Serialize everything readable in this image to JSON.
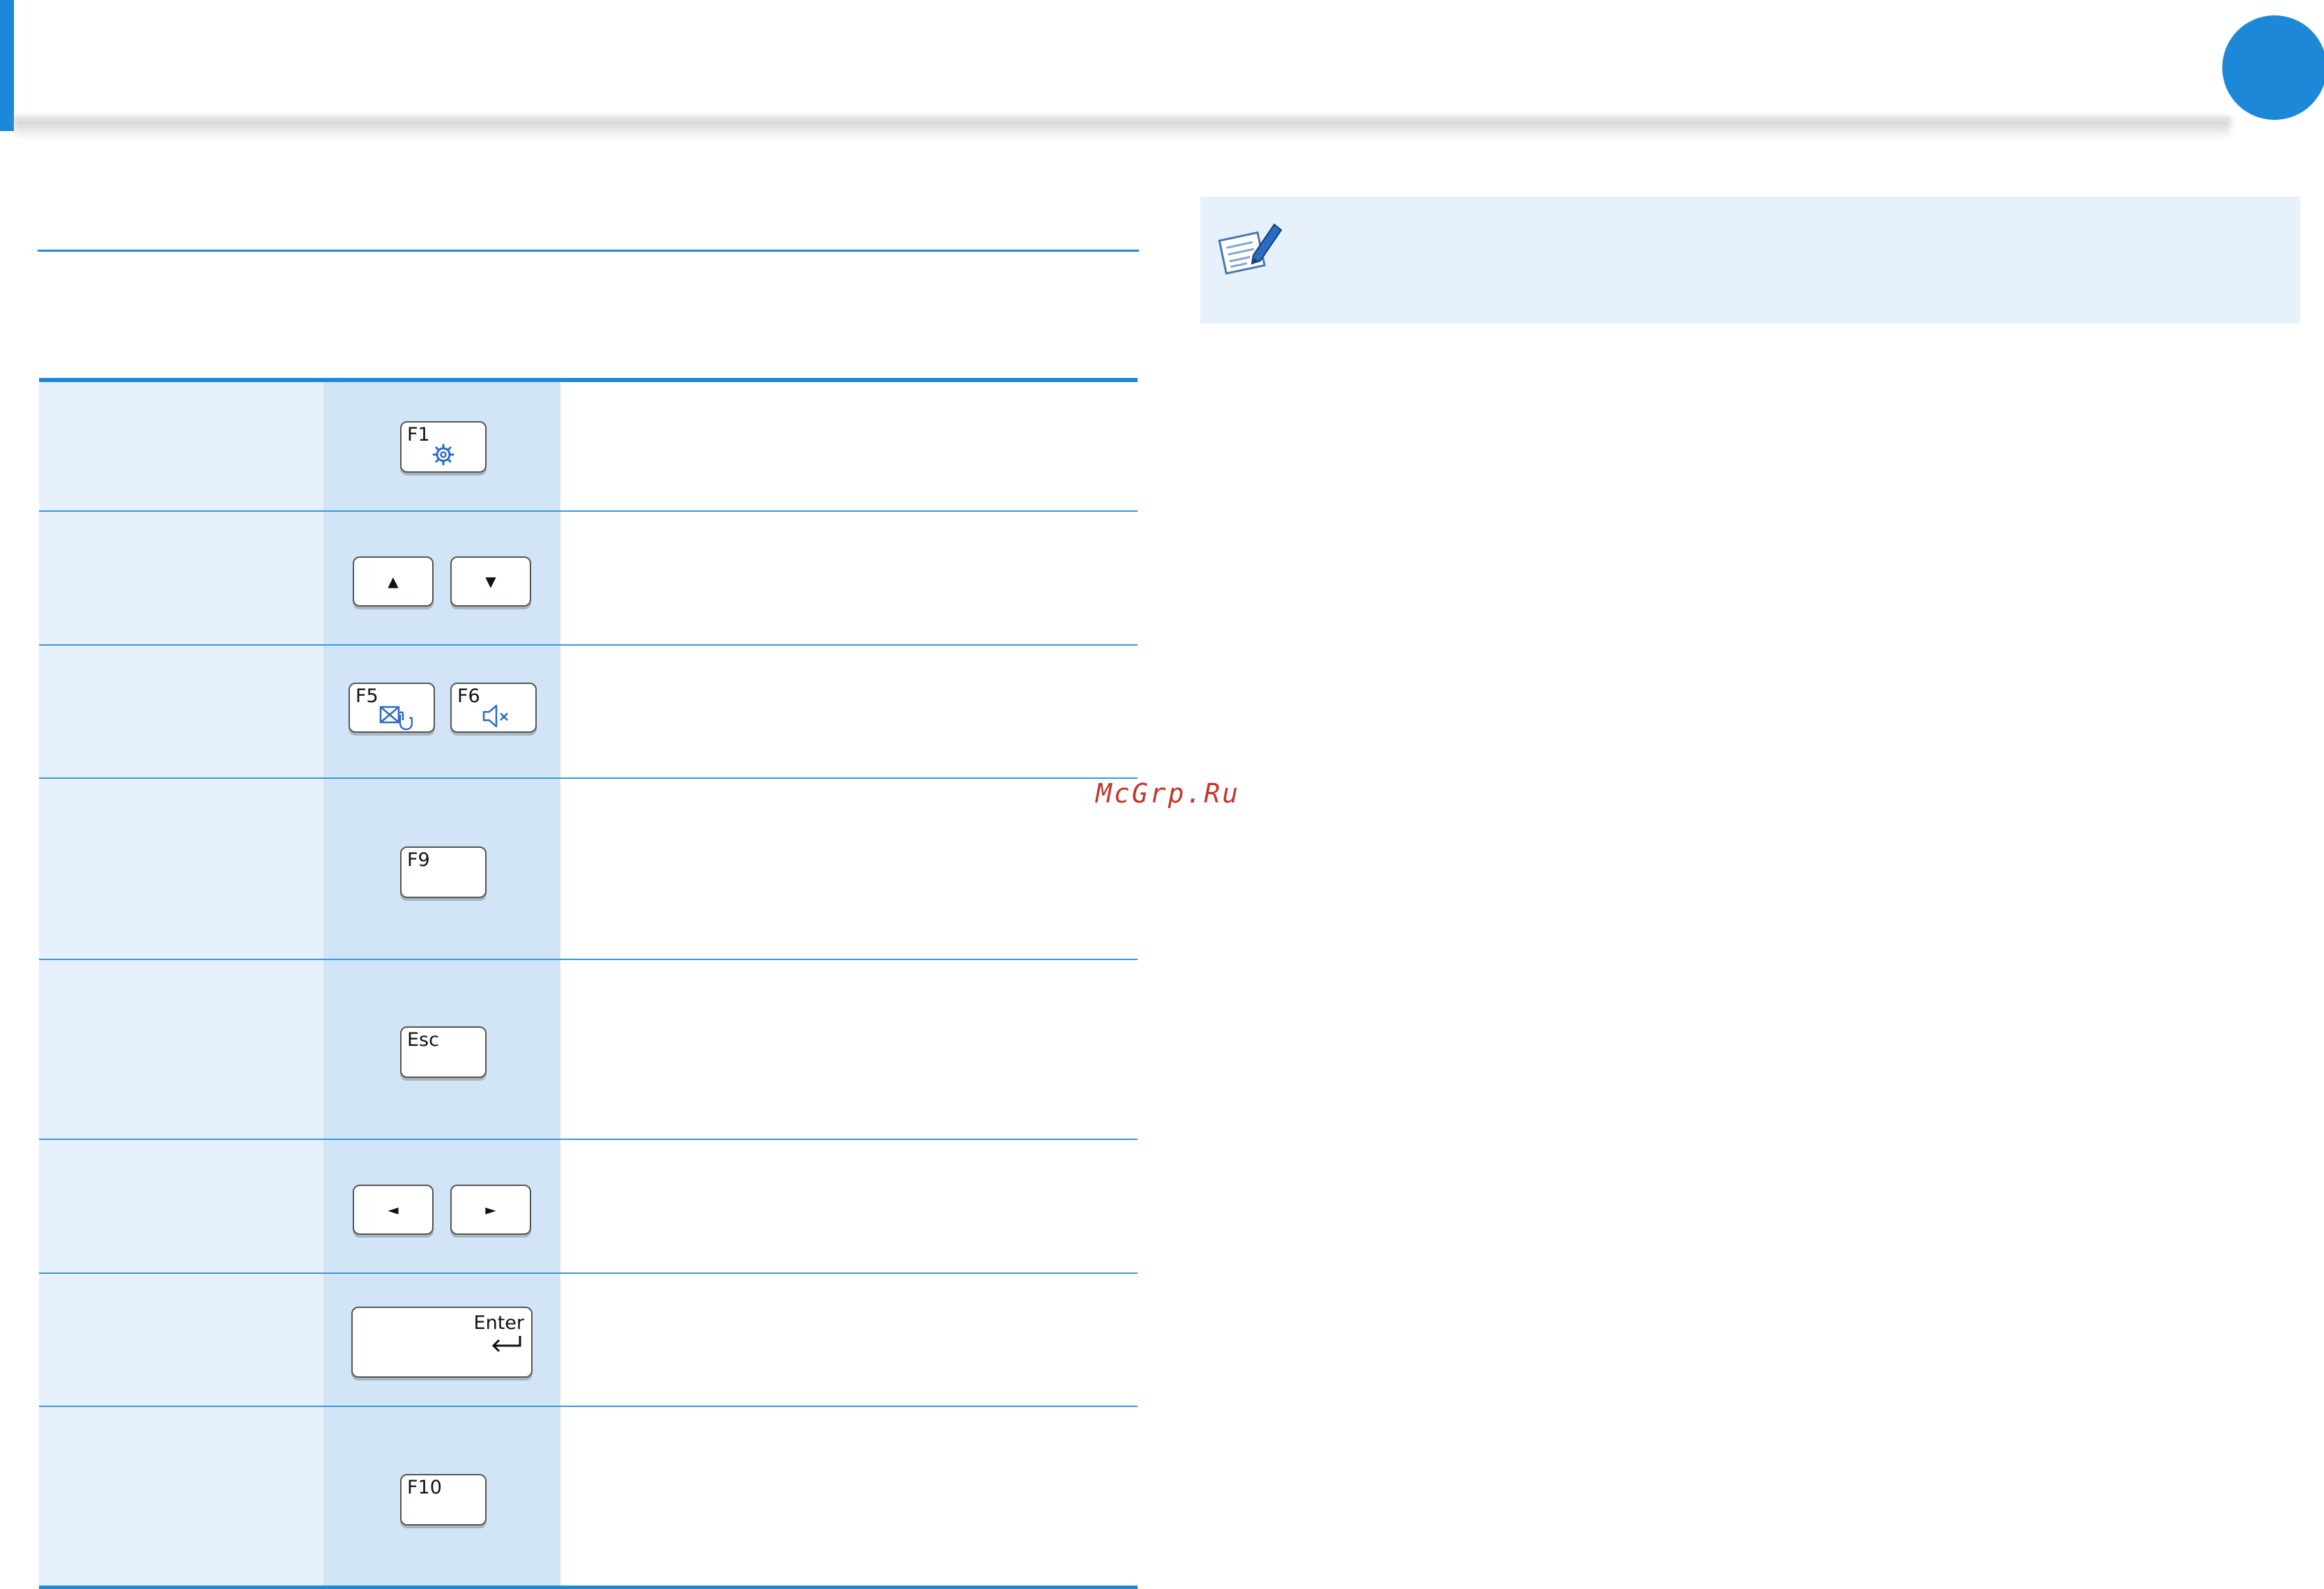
{
  "page": {
    "accent_color": "#1e88d8",
    "table_top_color": "#1e88d8",
    "name_column_bg": "#e6f1fb",
    "key_column_bg": "#d1e5f7"
  },
  "table": {
    "rows": [
      {
        "keys": [
          {
            "label": "F1",
            "icon": "settings-gear-icon"
          }
        ]
      },
      {
        "keys": [
          {
            "label": "▲"
          },
          {
            "label": "▼"
          }
        ]
      },
      {
        "keys": [
          {
            "label": "F5",
            "icon": "touchpad-off-icon"
          },
          {
            "label": "F6",
            "icon": "mute-icon"
          }
        ]
      },
      {
        "keys": [
          {
            "label": "F9"
          }
        ]
      },
      {
        "keys": [
          {
            "label": "Esc"
          }
        ]
      },
      {
        "keys": [
          {
            "label": "◄"
          },
          {
            "label": "►"
          }
        ]
      },
      {
        "keys": [
          {
            "label": "Enter",
            "icon": "enter-arrow-icon"
          }
        ]
      },
      {
        "keys": [
          {
            "label": "F10"
          }
        ]
      }
    ]
  },
  "note": {
    "icon": "note-pen-icon"
  },
  "watermark": {
    "text": "McGrp.Ru"
  }
}
